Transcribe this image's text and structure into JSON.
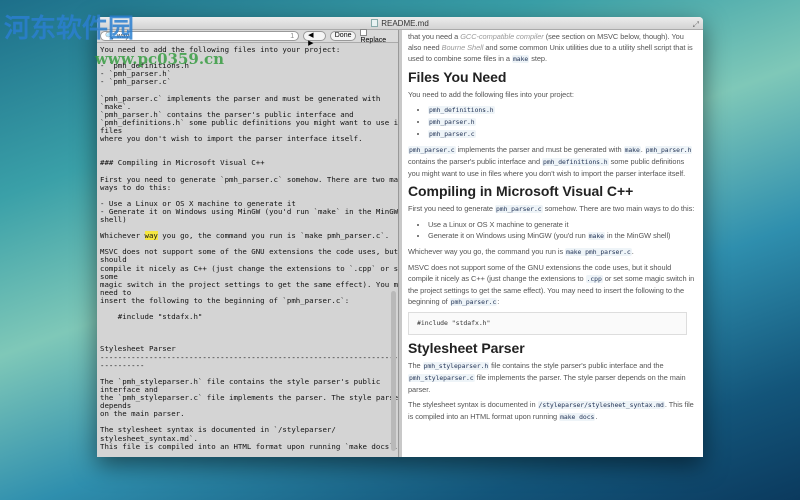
{
  "watermark": {
    "logo": "河东软件园",
    "url": "www.pc0359.cn"
  },
  "window": {
    "title": "README.md"
  },
  "findbar": {
    "query": "way",
    "count": "1",
    "done": "Done",
    "replace": "Replace"
  },
  "source": {
    "lines": [
      "You need to add the following files into your project:",
      "",
      "- `pmh_definitions.h`",
      "- `pmh_parser.h`",
      "- `pmh_parser.c`",
      "",
      "`pmh_parser.c` implements the parser and must be generated with",
      "`make`.",
      "`pmh_parser.h` contains the parser's public interface and",
      "`pmh_definitions.h` some public definitions you might want to use in",
      "files",
      "where you don't wish to import the parser interface itself.",
      "",
      "",
      "### Compiling in Microsoft Visual C++",
      "",
      "First you need to generate `pmh_parser.c` somehow. There are two main",
      "ways to do this:",
      "",
      "- Use a Linux or OS X machine to generate it",
      "- Generate it on Windows using MinGW (you'd run `make` in the MinGW",
      "shell)",
      "",
      null,
      "",
      "MSVC does not support some of the GNU extensions the code uses, but it",
      "should",
      "compile it nicely as C++ (just change the extensions to `.cpp` or set",
      "some",
      "magic switch in the project settings to get the same effect). You may",
      "need to",
      "insert the following to the beginning of `pmh_parser.c`:",
      "",
      "    #include \"stdafx.h\"",
      "",
      "",
      "",
      "Stylesheet Parser",
      "------------------------------------------------------------------------",
      "----------",
      "",
      "The `pmh_styleparser.h` file contains the style parser's public",
      "interface and",
      "the `pmh_styleparser.c` file implements the parser. The style parser",
      "depends",
      "on the main parser.",
      "",
      "The stylesheet syntax is documented in `/styleparser/",
      "stylesheet_syntax.md`.",
      "This file is compiled into an HTML format upon running `make docs`."
    ],
    "match_line": {
      "pre": "Whichever ",
      "hl": "way",
      "post": " you go, the command you run is `make pmh_parser.c`."
    }
  },
  "preview": {
    "intro": {
      "a": "that you need a ",
      "em1": "GCC-compatible compiler",
      "b": " (see section on MSVC below, though). You also need ",
      "em2": "Bourne Shell",
      "c": " and some common Unix utilities due to a utility shell script that is used to combine some files in a ",
      "code": "make",
      "d": " step."
    },
    "h_files": "Files You Need",
    "files_intro": "You need to add the following files into your project:",
    "files": [
      "pmh_definitions.h",
      "pmh_parser.h",
      "pmh_parser.c"
    ],
    "p2": {
      "c1": "pmh_parser.c",
      "t1": " implements the parser and must be generated with ",
      "c2": "make",
      "t2": ". ",
      "c3": "pmh_parser.h",
      "t3": " contains the parser's public interface and ",
      "c4": "pmh_definitions.h",
      "t4": " some public definitions you might want to use in files where you don't wish to import the parser interface itself."
    },
    "h_msvc": "Compiling in Microsoft Visual C++",
    "p3": {
      "t1": "First you need to generate ",
      "c1": "pmh_parser.c",
      "t2": " somehow. There are two main ways to do this:"
    },
    "ways": {
      "w1": "Use a Linux or OS X machine to generate it",
      "w2a": "Generate it on Windows using MinGW (you'd run ",
      "w2c": "make",
      "w2b": " in the MinGW shell)"
    },
    "p4": {
      "t1": "Whichever way you go, the command you run is ",
      "c1": "make pmh_parser.c",
      "t2": "."
    },
    "p5": {
      "t1": "MSVC does not support some of the GNU extensions the code uses, but it should compile it nicely as C++ (just change the extensions to ",
      "c1": ".cpp",
      "t2": " or set some magic switch in the project settings to get the same effect). You may need to insert the following to the beginning of ",
      "c2": "pmh_parser.c",
      "t3": ":"
    },
    "code": "#include \"stdafx.h\"",
    "h_style": "Stylesheet Parser",
    "p6": {
      "t1": "The ",
      "c1": "pmh_styleparser.h",
      "t2": " file contains the style parser's public interface and the ",
      "c2": "pmh_styleparser.c",
      "t3": " file implements the parser. The style parser depends on the main parser."
    },
    "p7": {
      "t1": "The stylesheet syntax is documented in ",
      "c1": "/styleparser/stylesheet_syntax.md",
      "t2": ". This file is compiled into an HTML format upon running ",
      "c2": "make docs",
      "t3": "."
    }
  }
}
